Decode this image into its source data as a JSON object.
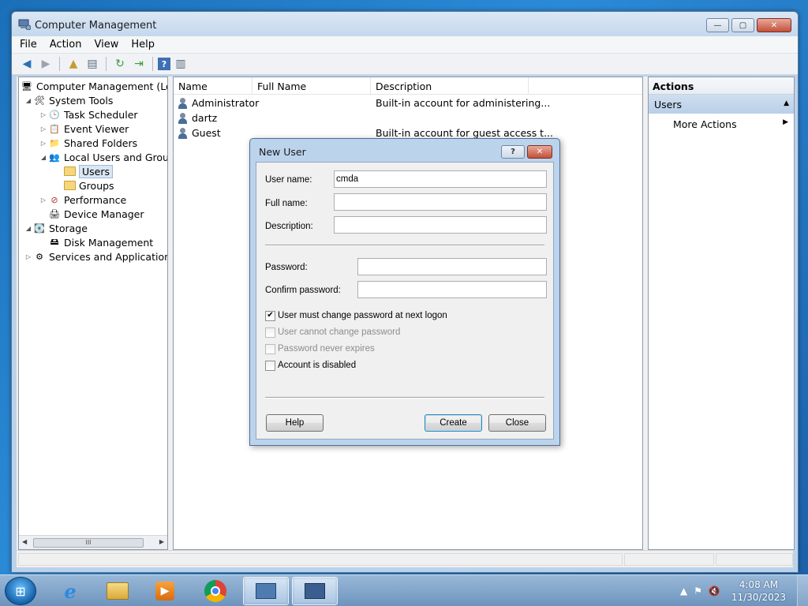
{
  "window": {
    "title": "Computer Management",
    "controls": {
      "minimize": "—",
      "maximize": "▢",
      "close": "✕"
    }
  },
  "menubar": {
    "items": [
      "File",
      "Action",
      "View",
      "Help"
    ]
  },
  "toolbar": {
    "icons": [
      "back-icon",
      "forward-icon",
      "up-folder-icon",
      "show-hide-tree-icon",
      "refresh-icon",
      "export-list-icon",
      "help-icon",
      "show-hide-action-pane-icon"
    ]
  },
  "tree": {
    "items": [
      {
        "label": "Computer Management (Local",
        "icon": "computer-management-icon"
      },
      {
        "label": "System Tools",
        "icon": "system-tools-icon"
      },
      {
        "label": "Task Scheduler",
        "icon": "clock-icon"
      },
      {
        "label": "Event Viewer",
        "icon": "event-viewer-icon"
      },
      {
        "label": "Shared Folders",
        "icon": "shared-folders-icon"
      },
      {
        "label": "Local Users and Groups",
        "icon": "users-groups-icon"
      },
      {
        "label": "Users",
        "icon": "folder-icon"
      },
      {
        "label": "Groups",
        "icon": "folder-icon"
      },
      {
        "label": "Performance",
        "icon": "performance-icon"
      },
      {
        "label": "Device Manager",
        "icon": "device-manager-icon"
      },
      {
        "label": "Storage",
        "icon": "storage-icon"
      },
      {
        "label": "Disk Management",
        "icon": "disk-icon"
      },
      {
        "label": "Services and Applications",
        "icon": "services-icon"
      }
    ],
    "scroll_thumb": "III"
  },
  "list": {
    "columns": [
      "Name",
      "Full Name",
      "Description"
    ],
    "rows": [
      {
        "name": "Administrator",
        "full_name": "",
        "description": "Built-in account for administering..."
      },
      {
        "name": "dartz",
        "full_name": "",
        "description": ""
      },
      {
        "name": "Guest",
        "full_name": "",
        "description": "Built-in account for guest access t..."
      }
    ]
  },
  "actions": {
    "title": "Actions",
    "section": "Users",
    "items": [
      "More Actions"
    ]
  },
  "dialog": {
    "title": "New User",
    "help_btn": "?",
    "close_btn": "✕",
    "user_name_label": "User name:",
    "user_name_value": "cmda",
    "full_name_label": "Full name:",
    "full_name_value": "",
    "description_label": "Description:",
    "description_value": "",
    "password_label": "Password:",
    "password_value": "",
    "confirm_label": "Confirm password:",
    "confirm_value": "",
    "checkboxes": [
      {
        "label": "User must change password at next logon",
        "checked": true,
        "enabled": true
      },
      {
        "label": "User cannot change password",
        "checked": false,
        "enabled": false
      },
      {
        "label": "Password never expires",
        "checked": false,
        "enabled": false
      },
      {
        "label": "Account is disabled",
        "checked": false,
        "enabled": true
      }
    ],
    "help_button": "Help",
    "create_button": "Create",
    "close_button": "Close"
  },
  "taskbar": {
    "apps": [
      "internet-explorer-icon",
      "windows-explorer-icon",
      "media-player-icon",
      "chrome-icon",
      "computer-management-icon",
      "network-icon"
    ],
    "time": "4:08 AM",
    "date": "11/30/2023"
  }
}
